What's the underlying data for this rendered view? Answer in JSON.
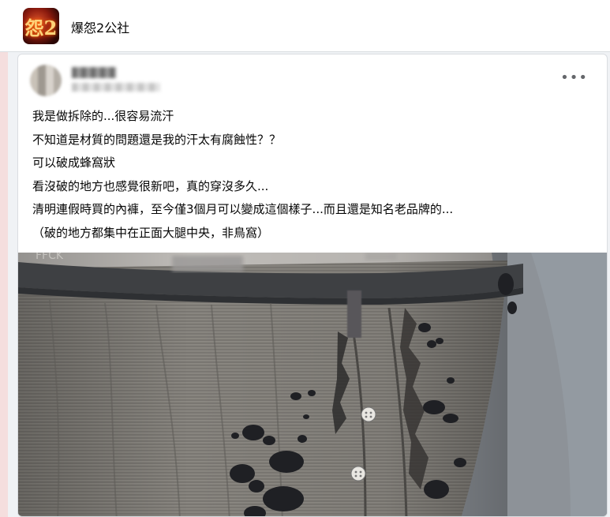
{
  "group": {
    "name": "爆怨2公社",
    "avatar_icon": "group-logo-icon"
  },
  "post": {
    "more_label": "•••",
    "lines": [
      "我是做拆除的...很容易流汗",
      "不知道是材質的問題還是我的汗太有腐蝕性？？",
      "可以破成蜂窩狀",
      "看沒破的地方也感覺很新吧，真的穿沒多久...",
      "清明連假時買的內褲，至今僅3個月可以變成這個樣子...而且還是知名老品牌的...",
      "（破的地方都集中在正面大腿中央，非鳥窩）"
    ],
    "photo_icon": "damaged-underwear-photo"
  },
  "colors": {
    "fabric": "#7b7873",
    "waistband": "#3e4043",
    "right_fabric": "#8d9298"
  }
}
